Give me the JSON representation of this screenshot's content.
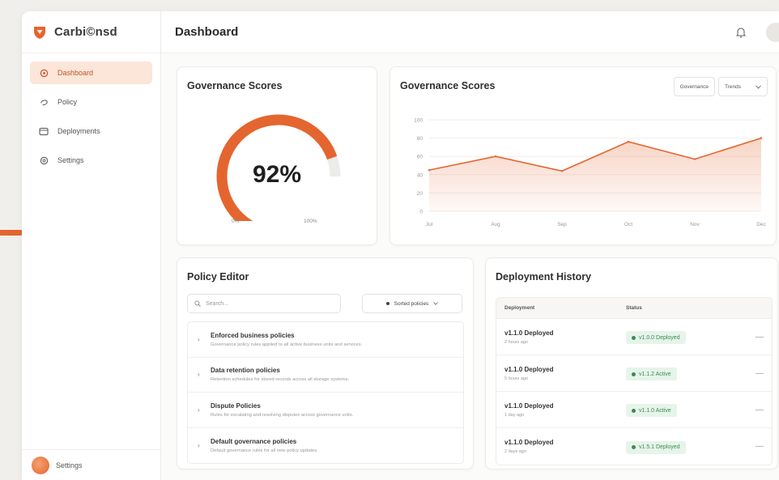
{
  "brand": {
    "name": "Carbi©nsd",
    "accent": "#e4652f"
  },
  "sidebar": {
    "items": [
      {
        "label": "Dashboard",
        "icon": "dashboard-icon",
        "active": true
      },
      {
        "label": "Policy",
        "icon": "policy-icon",
        "active": false
      },
      {
        "label": "Deployments",
        "icon": "deployments-icon",
        "active": false
      },
      {
        "label": "Settings",
        "icon": "settings-icon",
        "active": false
      }
    ],
    "footer_label": "Settings"
  },
  "header": {
    "title": "Dashboard"
  },
  "gauge": {
    "title": "Governance Scores",
    "value": 92,
    "value_text": "92%",
    "min_label": "0%",
    "max_label": "100%"
  },
  "line_chart": {
    "title": "Governance Scores",
    "control_1": "Governance",
    "control_2": "Trends"
  },
  "chart_data": {
    "type": "area",
    "title": "Governance Scores",
    "x": [
      "Jul",
      "Aug",
      "Sep",
      "Oct",
      "Nov",
      "Dec"
    ],
    "values": [
      45,
      60,
      44,
      76,
      57,
      80
    ],
    "yticks": [
      "100",
      "80",
      "60",
      "40",
      "20",
      "0"
    ],
    "ylim": [
      0,
      100
    ],
    "grid": true,
    "color": "#e4652f"
  },
  "policy": {
    "title": "Policy Editor",
    "search_placeholder": "Search...",
    "filter_label": "Sorted policies",
    "rows": [
      {
        "name": "Enforced business policies",
        "desc": "Governance policy rules applied to all active business units and services."
      },
      {
        "name": "Data retention policies",
        "desc": "Retention schedules for stored records across all storage systems."
      },
      {
        "name": "Dispute Policies",
        "desc": "Rules for escalating and resolving disputes across governance units."
      },
      {
        "name": "Default governance policies",
        "desc": "Default governance rules for all new policy updates."
      }
    ]
  },
  "deployments": {
    "title": "Deployment History",
    "col_deployment": "Deployment",
    "col_status": "Status",
    "rows": [
      {
        "version": "v1.1.0 Deployed",
        "time": "2 hours ago",
        "badge": "v1.0.0 Deployed"
      },
      {
        "version": "v1.1.0 Deployed",
        "time": "5 hours ago",
        "badge": "v1.1.2 Active"
      },
      {
        "version": "v1.1.0 Deployed",
        "time": "1 day ago",
        "badge": "v1.1.0 Active"
      },
      {
        "version": "v1.1.0 Deployed",
        "time": "2 days ago",
        "badge": "v1.5.1 Deployed"
      }
    ],
    "badge_color": "#3c8a55"
  }
}
